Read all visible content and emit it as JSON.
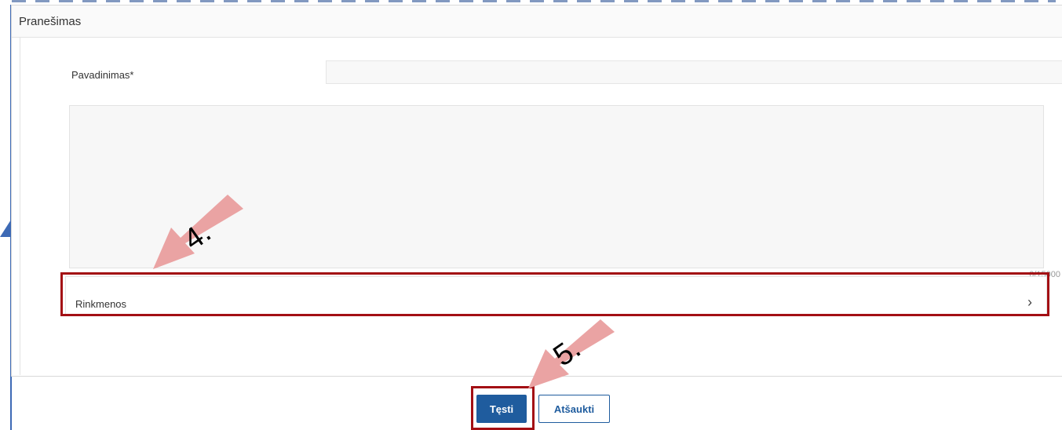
{
  "panel": {
    "title": "Pranešimas",
    "name_label": "Pavadinimas*",
    "name_value": "",
    "char_counter": "0/15000",
    "files_label": "Rinkmenos",
    "chevron": "›"
  },
  "actions": {
    "continue_label": "Tęsti",
    "cancel_label": "Atšaukti"
  },
  "annotations": {
    "step4": "4.",
    "step5": "5."
  },
  "colors": {
    "primary": "#1f5c9e",
    "highlight": "#a30f14",
    "annotation_arrow": "#eaa3a3",
    "frame": "#3d6ab5"
  },
  "icons": {
    "files_chevron": "chevron-right-icon"
  }
}
